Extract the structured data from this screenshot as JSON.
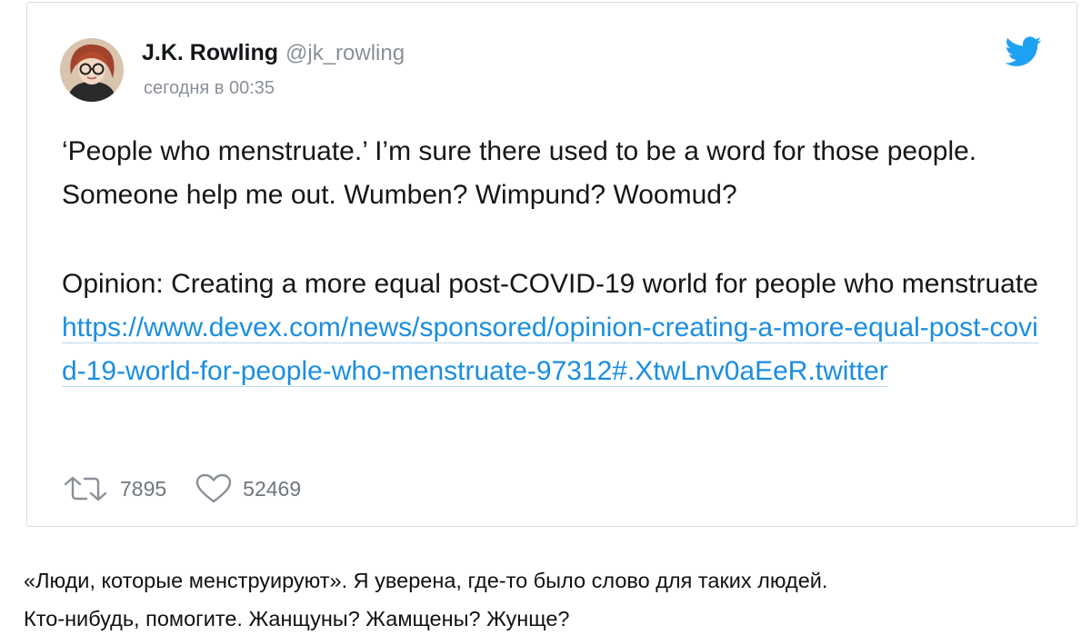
{
  "tweet": {
    "author": {
      "name": "J.K. Rowling",
      "handle": "@jk_rowling"
    },
    "timestamp": "сегодня в 00:35",
    "text": {
      "paragraph1": "‘People who menstruate.’ I’m sure there used to be a word for those people. Someone help me out. Wumben? Wimpund? Woomud?",
      "paragraph2_text": "Opinion: Creating a more equal post-COVID-19 world for people who menstruate ",
      "link": "https://www.devex.com/news/sponsored/opinion-creating-a-more-equal-post-covid-19-world-for-people-who-menstruate-97312#.XtwLnv0aEeR.twitter"
    },
    "retweets": "7895",
    "likes": "52469",
    "icons": {
      "brand": "twitter-bird-icon",
      "retweet": "retweet-icon",
      "like": "heart-icon"
    }
  },
  "caption": {
    "line1": "«Люди, которые менструируют». Я уверена, где-то было слово для таких людей.",
    "line2": "Кто-нибудь, помогите. Жанщуны? Жамщены? Жунще?"
  },
  "colors": {
    "link": "#1b8ee0",
    "twitter_brand": "#1da1f2",
    "muted_text": "#8a9099",
    "card_border": "#d9dde1"
  }
}
